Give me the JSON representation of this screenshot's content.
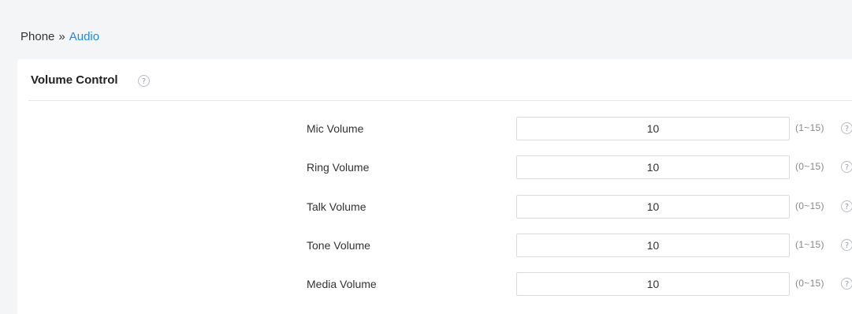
{
  "breadcrumb": {
    "parent": "Phone",
    "separator": "»",
    "current": "Audio"
  },
  "section": {
    "title": "Volume Control",
    "help_icon": "question-circle-icon"
  },
  "fields": [
    {
      "label": "Mic Volume",
      "value": "10",
      "range": "(1~15)"
    },
    {
      "label": "Ring Volume",
      "value": "10",
      "range": "(0~15)"
    },
    {
      "label": "Talk Volume",
      "value": "10",
      "range": "(0~15)"
    },
    {
      "label": "Tone Volume",
      "value": "10",
      "range": "(1~15)"
    },
    {
      "label": "Media Volume",
      "value": "10",
      "range": "(0~15)"
    }
  ],
  "colors": {
    "accent": "#1e88e5",
    "page_bg": "#f4f5f7",
    "panel_bg": "#ffffff"
  }
}
